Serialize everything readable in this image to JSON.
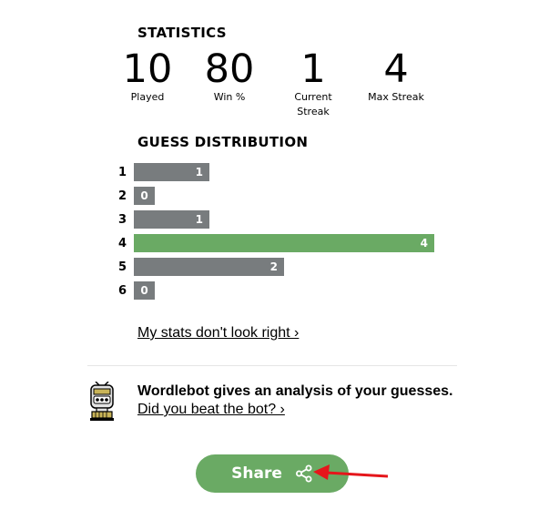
{
  "statistics": {
    "heading": "STATISTICS",
    "items": [
      {
        "value": "10",
        "label": "Played"
      },
      {
        "value": "80",
        "label": "Win %"
      },
      {
        "value": "1",
        "label": "Current\nStreak"
      },
      {
        "value": "4",
        "label": "Max Streak"
      }
    ]
  },
  "distribution": {
    "heading": "GUESS DISTRIBUTION",
    "rows": [
      {
        "guess": "1",
        "count": "1",
        "fraction": 0.25,
        "highlight": false
      },
      {
        "guess": "2",
        "count": "0",
        "fraction": 0.0,
        "highlight": false
      },
      {
        "guess": "3",
        "count": "1",
        "fraction": 0.25,
        "highlight": false
      },
      {
        "guess": "4",
        "count": "4",
        "fraction": 1.0,
        "highlight": true
      },
      {
        "guess": "5",
        "count": "2",
        "fraction": 0.5,
        "highlight": false
      },
      {
        "guess": "6",
        "count": "0",
        "fraction": 0.0,
        "highlight": false
      }
    ]
  },
  "stats_link": "My stats don't look right ›",
  "wordlebot": {
    "icon": "robot-icon",
    "title": "Wordlebot gives an analysis of your guesses.",
    "link": "Did you beat the bot? ›"
  },
  "share": {
    "label": "Share",
    "icon": "share-icon"
  },
  "annotation": {
    "icon": "red-arrow-icon",
    "color": "#e5161b"
  },
  "colors": {
    "bar": "#787c7e",
    "highlight": "#6aaa64"
  }
}
